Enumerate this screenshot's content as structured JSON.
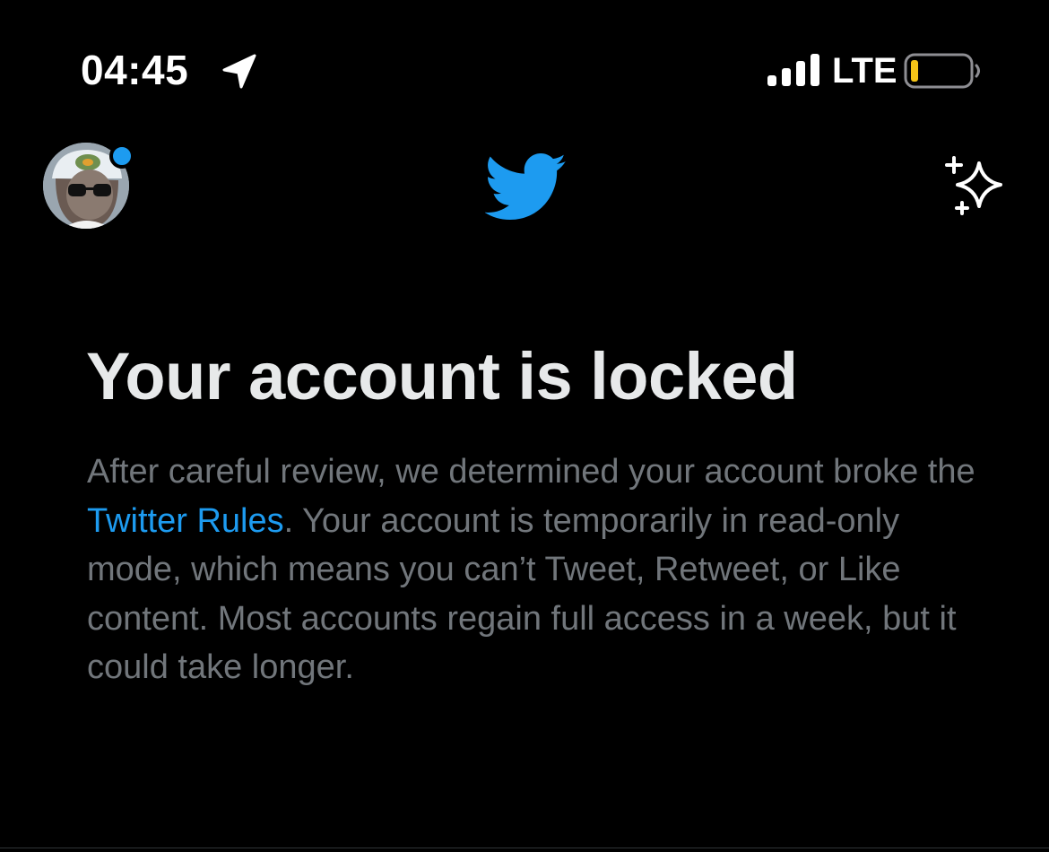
{
  "status_bar": {
    "time": "04:45",
    "network": "LTE",
    "icons": [
      "location-arrow-icon",
      "signal-bars-icon",
      "battery-low-icon"
    ]
  },
  "nav": {
    "avatar_icon": "user-avatar",
    "logo_icon": "twitter-bird-icon",
    "sparkle_icon": "sparkle-icon"
  },
  "notice": {
    "title": "Your account is locked",
    "body_before_link": "After careful review, we determined your account broke the ",
    "link_text": "Twitter Rules",
    "body_after_link": ". Your account is temporarily in read-only mode, which means you can’t Tweet, Retweet, or Like content. Most accounts regain full access in a week, but it could take longer."
  },
  "colors": {
    "background": "#000000",
    "accent": "#1d9bf0",
    "title_text": "#e7e9ea",
    "body_text": "#71767b",
    "battery_level": "#f5c518"
  }
}
